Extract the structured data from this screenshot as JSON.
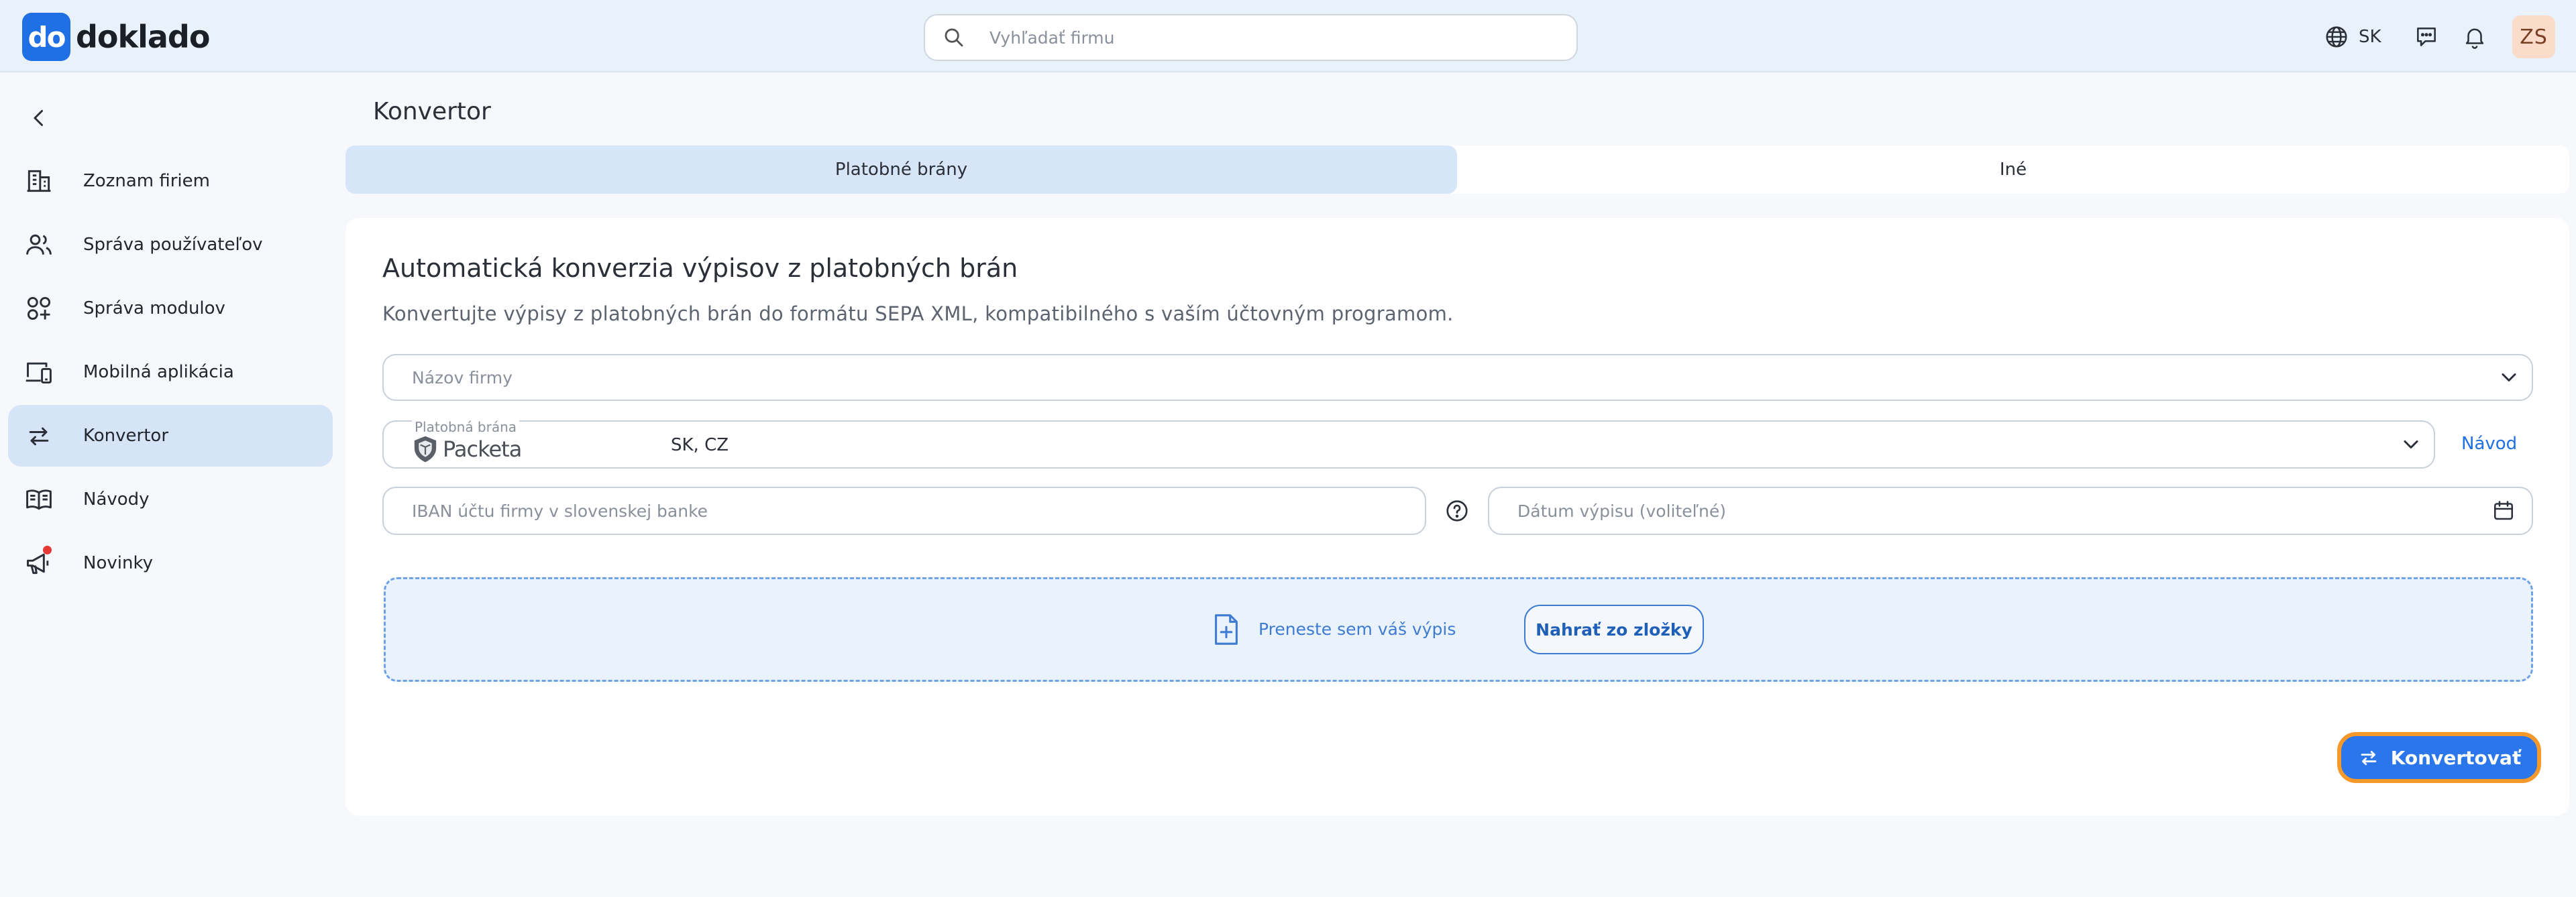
{
  "app": {
    "logo_mark": "do",
    "logo_text": "doklado"
  },
  "search": {
    "placeholder": "Vyhľadať firmu"
  },
  "topbar": {
    "language": "SK",
    "avatar_initials": "ZS"
  },
  "sidebar": {
    "items": [
      {
        "label": "Zoznam firiem",
        "icon": "building-icon"
      },
      {
        "label": "Správa používateľov",
        "icon": "users-icon"
      },
      {
        "label": "Správa modulov",
        "icon": "modules-icon"
      },
      {
        "label": "Mobilná aplikácia",
        "icon": "mobile-app-icon"
      },
      {
        "label": "Konvertor",
        "icon": "convert-icon",
        "active": true
      },
      {
        "label": "Návody",
        "icon": "book-icon"
      },
      {
        "label": "Novinky",
        "icon": "megaphone-icon"
      }
    ]
  },
  "page": {
    "title": "Konvertor"
  },
  "tabs": [
    {
      "label": "Platobné brány",
      "active": true
    },
    {
      "label": "Iné",
      "active": false
    }
  ],
  "card": {
    "title": "Automatická konverzia výpisov z platobných brán",
    "description": "Konvertujte výpisy z platobných brán do formátu SEPA XML, kompatibilného s vaším účtovným programom."
  },
  "form": {
    "company_placeholder": "Názov firmy",
    "gateway_label": "Platobná brána",
    "gateway_brand": "Packeta",
    "gateway_value": "SK, CZ",
    "guide_link": "Návod",
    "iban_placeholder": "IBAN účtu firmy v slovenskej banke",
    "date_placeholder": "Dátum výpisu (voliteľné)"
  },
  "dropzone": {
    "text": "Preneste sem váš výpis",
    "upload_button": "Nahrať zo zložky"
  },
  "actions": {
    "convert_button": "Konvertovať"
  },
  "colors": {
    "accent": "#2a76ea",
    "highlight": "#f59a2a",
    "active_bg": "#d6e4f8"
  }
}
